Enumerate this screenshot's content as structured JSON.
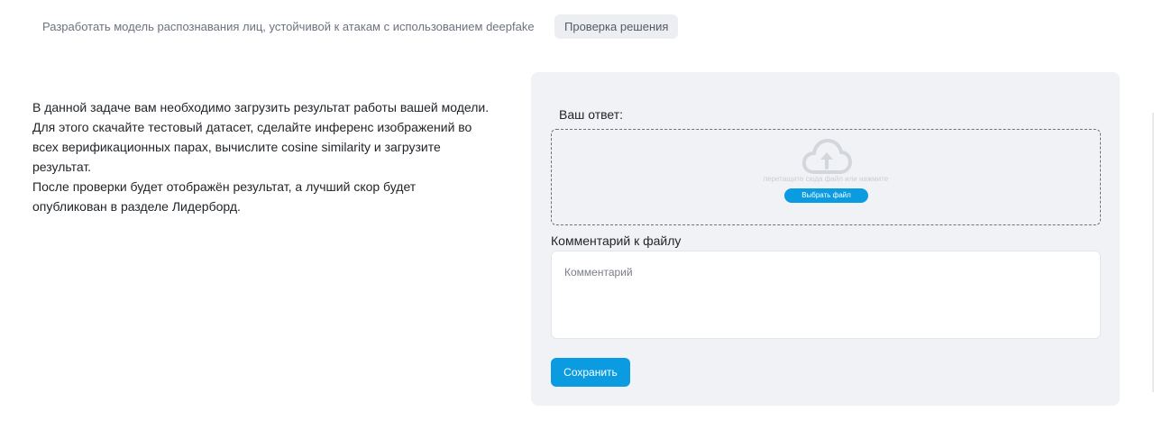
{
  "tabs": {
    "task_label": "Разработать модель распознавания лиц, устойчивой к атакам с использованием deepfake",
    "check_label": "Проверка решения"
  },
  "description": {
    "lines": [
      "В данной задаче вам необходимо загрузить результат работы вашей модели.",
      "Для этого скачайте тестовый датасет, сделайте инференс изображений во",
      "всех верификационных парах, вычислите cosine similarity и загрузите",
      "результат.",
      "После проверки будет отображён результат, а лучший скор будет",
      "опубликован в разделе Лидерборд."
    ]
  },
  "form": {
    "answer_label": "Ваш ответ:",
    "dropzone": {
      "icon": "cloud-upload-icon",
      "hint": "перетащите сюда файл или нажмите",
      "choose_label": "Выбрать файл"
    },
    "comment_label": "Комментарий к файлу",
    "comment_placeholder": "Комментарий",
    "comment_value": "",
    "save_label": "Сохранить"
  },
  "colors": {
    "accent": "#0b9be0",
    "panel_bg": "#f1f2f5",
    "active_tab_bg": "#eceef2",
    "text": "#212529",
    "muted_text": "#6c7280"
  }
}
